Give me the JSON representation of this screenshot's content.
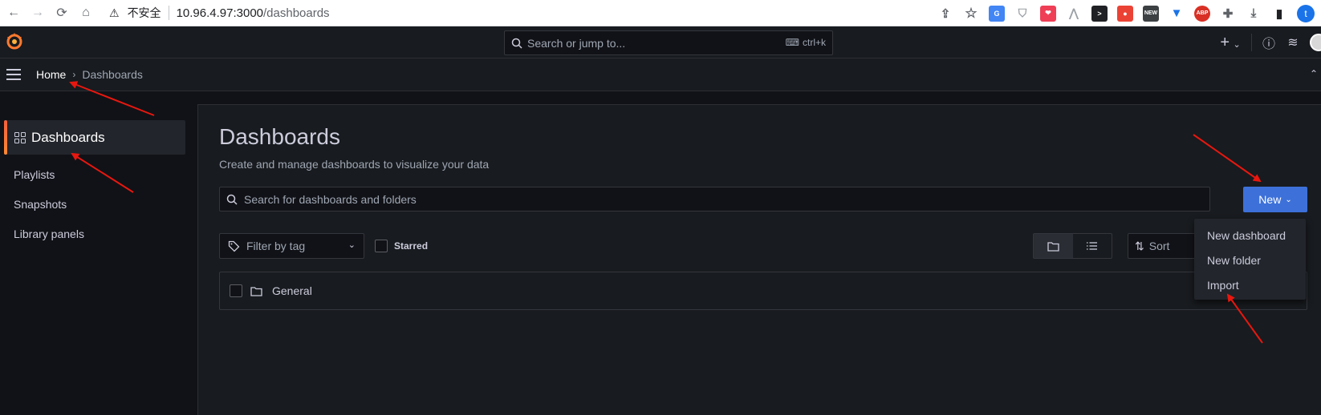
{
  "browser": {
    "insecure_label": "不安全",
    "url_host": "10.96.4.97:3000",
    "url_path": "/dashboards",
    "profile_letter": "t",
    "ext_abp": "ABP",
    "ext_new": "NEW"
  },
  "topbar": {
    "search_placeholder": "Search or jump to...",
    "search_shortcut": "ctrl+k",
    "add_label": "+",
    "add_caret": "⌄"
  },
  "breadcrumb": {
    "home": "Home",
    "separator": "›",
    "current": "Dashboards"
  },
  "sidebar": {
    "active_item": "Dashboards",
    "items": [
      "Playlists",
      "Snapshots",
      "Library panels"
    ]
  },
  "main": {
    "title": "Dashboards",
    "subtitle": "Create and manage dashboards to visualize your data",
    "search_placeholder": "Search for dashboards and folders",
    "new_button": "New",
    "tag_filter_placeholder": "Filter by tag",
    "starred_label": "Starred",
    "sort_label": "Sort",
    "folders": [
      {
        "name": "General"
      }
    ]
  },
  "new_menu": {
    "items": [
      "New dashboard",
      "New folder",
      "Import"
    ]
  },
  "colors": {
    "accent_orange": "#ff7a2f",
    "primary_blue": "#3d71d9",
    "annotation_red": "#e8170f",
    "background": "#111217",
    "panel": "#181b1f"
  }
}
